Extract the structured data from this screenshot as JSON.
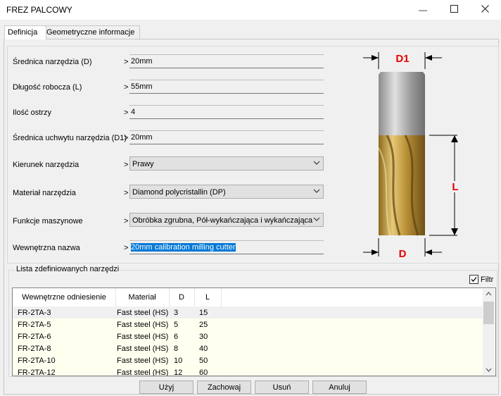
{
  "window": {
    "title": "FREZ PALCOWY",
    "minimize_glyph": "—",
    "maximize_glyph": "☐",
    "close_glyph": "✕"
  },
  "tabs": [
    {
      "label": "Definicja",
      "active": true
    },
    {
      "label": "Geometryczne informacje",
      "active": false
    }
  ],
  "form": {
    "arrow": ">",
    "fields": [
      {
        "label": "Średnica narzędzia (D)",
        "value": "20mm"
      },
      {
        "label": "Długość robocza (L)",
        "value": "55mm"
      },
      {
        "label": "Ilość ostrzy",
        "value": "4"
      },
      {
        "label": "Średnica uchwytu narzędzia (D1)",
        "value": "20mm"
      }
    ],
    "combos": [
      {
        "label": "Kierunek narzędzia",
        "value": "Prawy"
      },
      {
        "label": "Materiał narzędzia",
        "value": "Diamond polycristallin (DP)"
      },
      {
        "label": "Funkcje maszynowe",
        "value": "Obróbka zgrubna, Pół-wykańczająca i wykańczająca"
      }
    ],
    "internal_name": {
      "label": "Wewnętrzna nazwa",
      "value": "20mm calibration milling cutter"
    }
  },
  "diagram": {
    "label_d1": "D1",
    "label_l": "L",
    "label_d": "D",
    "dimension_color": "#e60000"
  },
  "tool_list": {
    "group_title": "Lista zdefiniowanych narzędzi",
    "filter_label": "Filtr",
    "filter_checked": true,
    "columns": [
      "Wewnętrzne odniesienie",
      "Materiał",
      "D",
      "L"
    ],
    "rows": [
      [
        "FR-2TA-3",
        "Fast steel (HS)",
        "3",
        "15"
      ],
      [
        "FR-2TA-5",
        "Fast steel (HS)",
        "5",
        "25"
      ],
      [
        "FR-2TA-6",
        "Fast steel (HS)",
        "6",
        "30"
      ],
      [
        "FR-2TA-8",
        "Fast steel (HS)",
        "8",
        "40"
      ],
      [
        "FR-2TA-10",
        "Fast steel (HS)",
        "10",
        "50"
      ],
      [
        "FR-2TA-12",
        "Fast steel (HS)",
        "12",
        "60"
      ]
    ]
  },
  "buttons": {
    "use": "Użyj",
    "save": "Zachowaj",
    "delete": "Usuń",
    "cancel": "Anuluj"
  }
}
